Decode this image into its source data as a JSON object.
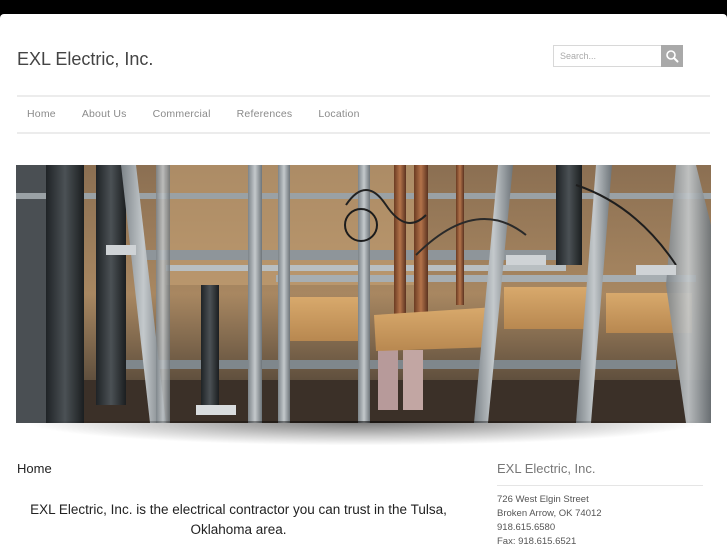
{
  "header": {
    "site_title": "EXL Electric, Inc.",
    "search_placeholder": "Search..."
  },
  "nav": {
    "items": [
      {
        "label": "Home"
      },
      {
        "label": "About Us"
      },
      {
        "label": "Commercial"
      },
      {
        "label": "References"
      },
      {
        "label": "Location"
      }
    ]
  },
  "hero": {
    "icon": "electrical-conduit-photo"
  },
  "main": {
    "heading": "Home",
    "intro": "EXL Electric, Inc. is the electrical contractor you can trust in the Tulsa, Oklahoma area."
  },
  "sidebar": {
    "heading": "EXL Electric, Inc.",
    "address_lines": [
      "726 West Elgin Street",
      "Broken Arrow, OK 74012",
      "918.615.6580",
      "Fax: 918.615.6521"
    ]
  },
  "colors": {
    "background": "#000000",
    "page": "#ffffff",
    "nav_text": "#8a8a8a",
    "search_button": "#a9a9a9"
  }
}
